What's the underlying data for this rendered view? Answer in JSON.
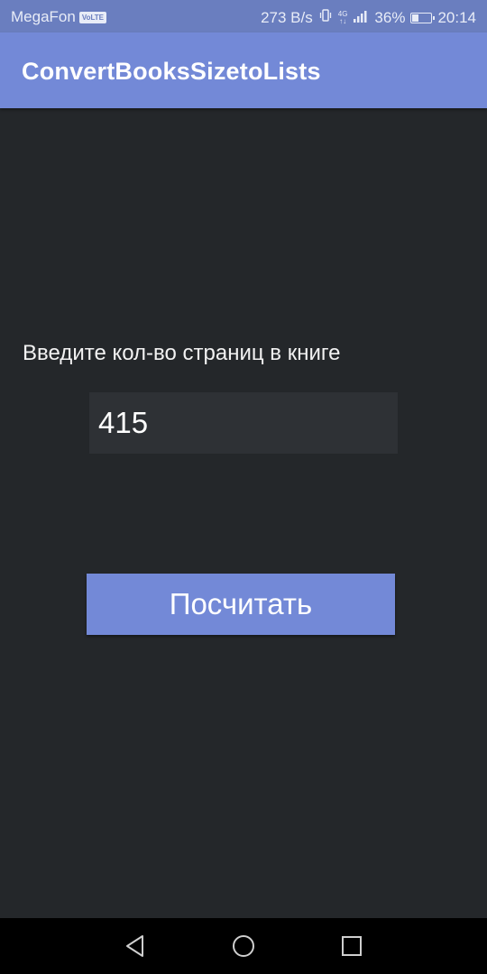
{
  "status_bar": {
    "carrier": "MegaFon",
    "volte": "VoLTE",
    "speed": "273 B/s",
    "network": "4G",
    "battery_percent": "36%",
    "battery_level": 0.36,
    "time": "20:14"
  },
  "app_bar": {
    "title": "ConvertBooksSizetoLists"
  },
  "main": {
    "prompt_label": "Введите кол-во страниц в книге",
    "pages_input_value": "415",
    "calculate_button_label": "Посчитать"
  },
  "colors": {
    "accent": "#7389d7",
    "background": "#24272a",
    "input_background": "#2e3135"
  },
  "nav_bar": {
    "back_icon": "back-triangle-icon",
    "home_icon": "home-circle-icon",
    "recents_icon": "recents-square-icon"
  }
}
